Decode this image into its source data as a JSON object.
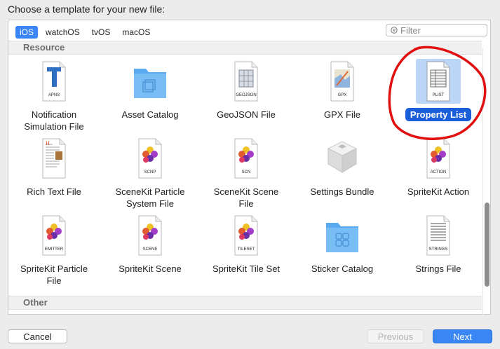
{
  "dialog": {
    "prompt": "Choose a template for your new file:"
  },
  "platform_tabs": [
    {
      "label": "iOS",
      "selected": true
    },
    {
      "label": "watchOS",
      "selected": false
    },
    {
      "label": "tvOS",
      "selected": false
    },
    {
      "label": "macOS",
      "selected": false
    }
  ],
  "filter": {
    "placeholder": "Filter",
    "value": "",
    "icon": "filter-icon"
  },
  "sections": {
    "resource": "Resource",
    "other": "Other"
  },
  "templates": [
    {
      "label": "Notification Simulation File",
      "line1": "Notification",
      "line2": "Simulation File",
      "icon": "apns-icon",
      "caption": "APNS"
    },
    {
      "label": "Asset Catalog",
      "line1": "Asset Catalog",
      "line2": "",
      "icon": "folder-icon",
      "caption": ""
    },
    {
      "label": "GeoJSON File",
      "line1": "GeoJSON File",
      "line2": "",
      "icon": "geojson-icon",
      "caption": "GEOJSON"
    },
    {
      "label": "GPX File",
      "line1": "GPX File",
      "line2": "",
      "icon": "gpx-icon",
      "caption": "GPX"
    },
    {
      "label": "Property List",
      "line1": "Property List",
      "line2": "",
      "icon": "plist-icon",
      "caption": "PLIST",
      "selected": true
    },
    {
      "label": "Rich Text File",
      "line1": "Rich Text File",
      "line2": "",
      "icon": "rich-text-icon",
      "caption": ""
    },
    {
      "label": "SceneKit Particle System File",
      "line1": "SceneKit Particle",
      "line2": "System File",
      "icon": "scnp-icon",
      "caption": "SCNP"
    },
    {
      "label": "SceneKit Scene File",
      "line1": "SceneKit Scene",
      "line2": "File",
      "icon": "scn-icon",
      "caption": "SCN"
    },
    {
      "label": "Settings Bundle",
      "line1": "Settings Bundle",
      "line2": "",
      "icon": "settings-bundle-icon",
      "caption": ""
    },
    {
      "label": "SpriteKit Action",
      "line1": "SpriteKit Action",
      "line2": "",
      "icon": "action-icon",
      "caption": "ACTION"
    },
    {
      "label": "SpriteKit Particle File",
      "line1": "SpriteKit Particle",
      "line2": "File",
      "icon": "emitter-icon",
      "caption": "EMITTER"
    },
    {
      "label": "SpriteKit Scene",
      "line1": "SpriteKit Scene",
      "line2": "",
      "icon": "scene-icon",
      "caption": "SCENE"
    },
    {
      "label": "SpriteKit Tile Set",
      "line1": "SpriteKit Tile Set",
      "line2": "",
      "icon": "tileset-icon",
      "caption": "TILESET"
    },
    {
      "label": "Sticker Catalog",
      "line1": "Sticker Catalog",
      "line2": "",
      "icon": "sticker-folder-icon",
      "caption": ""
    },
    {
      "label": "Strings File",
      "line1": "Strings File",
      "line2": "",
      "icon": "strings-icon",
      "caption": "STRINGS"
    }
  ],
  "buttons": {
    "cancel": "Cancel",
    "previous": "Previous",
    "next": "Next"
  },
  "colors": {
    "accent": "#3b86f5",
    "selection": "#1a5fd9",
    "annotation": "#e01010"
  }
}
